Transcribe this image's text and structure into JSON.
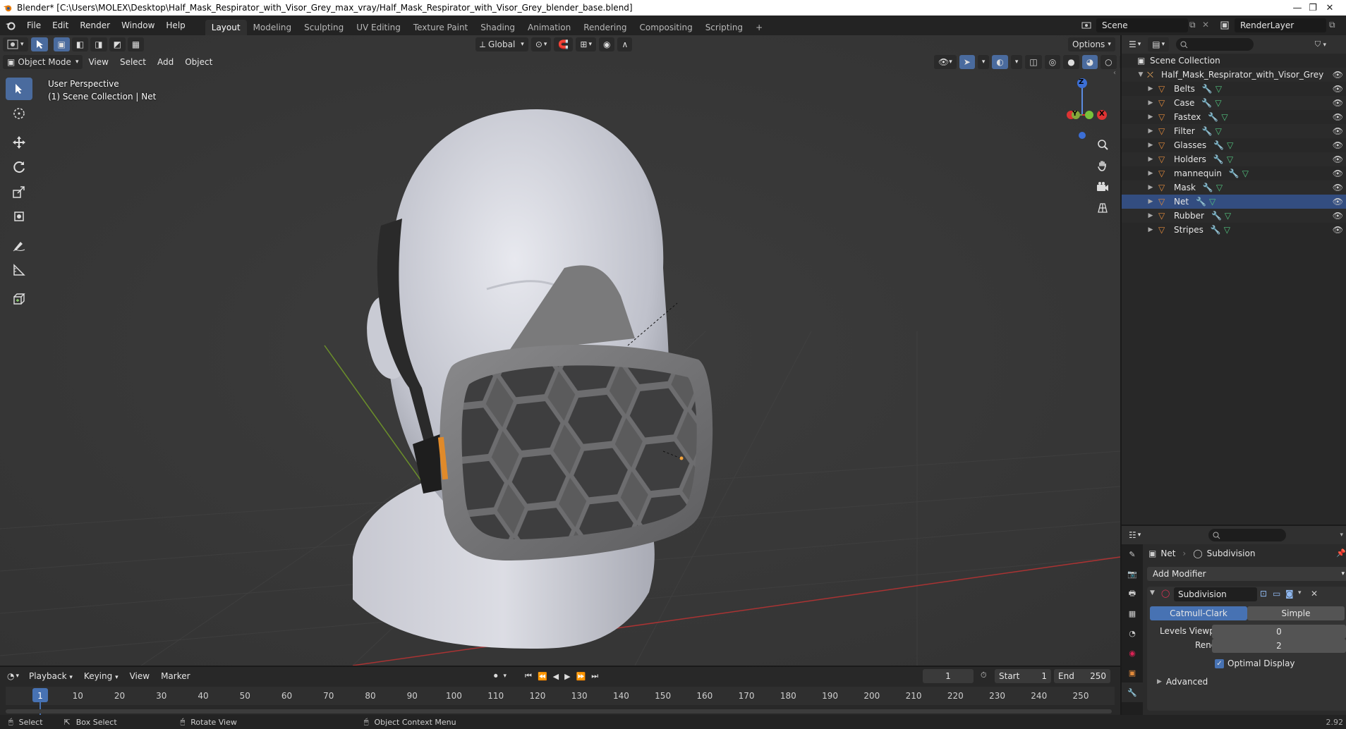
{
  "window": {
    "title": "Blender* [C:\\Users\\MOLEX\\Desktop\\Half_Mask_Respirator_with_Visor_Grey_max_vray/Half_Mask_Respirator_with_Visor_Grey_blender_base.blend]"
  },
  "menu": [
    "File",
    "Edit",
    "Render",
    "Window",
    "Help"
  ],
  "workspaces": [
    "Layout",
    "Modeling",
    "Sculpting",
    "UV Editing",
    "Texture Paint",
    "Shading",
    "Animation",
    "Rendering",
    "Compositing",
    "Scripting"
  ],
  "active_workspace": "Layout",
  "scene": {
    "name": "Scene",
    "view_layer": "RenderLayer"
  },
  "viewport": {
    "transform_orientation": "Global",
    "options_label": "Options",
    "mode": "Object Mode",
    "header_menus": [
      "View",
      "Select",
      "Add",
      "Object"
    ],
    "view_name": "User Perspective",
    "collection_info": "(1) Scene Collection | Net",
    "gizmo": {
      "z": "Z",
      "y": "Y",
      "x": "X"
    }
  },
  "outliner": {
    "root": "Scene Collection",
    "collection": "Half_Mask_Respirator_with_Visor_Grey",
    "objects": [
      "Belts",
      "Case",
      "Fastex",
      "Filter",
      "Glasses",
      "Holders",
      "mannequin",
      "Mask",
      "Net",
      "Rubber",
      "Stripes"
    ],
    "active_object": "Net"
  },
  "properties": {
    "object": "Net",
    "modifier_breadcrumb": "Subdivision",
    "add_modifier": "Add Modifier",
    "modifier_name": "Subdivision",
    "type_options": [
      "Catmull-Clark",
      "Simple"
    ],
    "selected_type": "Catmull-Clark",
    "levels_viewport_label": "Levels Viewport",
    "levels_viewport_value": "0",
    "render_label": "Render",
    "render_value": "2",
    "optimal_display_label": "Optimal Display",
    "optimal_display_checked": true,
    "advanced_label": "Advanced"
  },
  "timeline": {
    "menus": [
      "Playback",
      "Keying",
      "View",
      "Marker"
    ],
    "current_frame": "1",
    "start_label": "Start",
    "start_value": "1",
    "end_label": "End",
    "end_value": "250",
    "ruler": [
      "1",
      "10",
      "20",
      "30",
      "40",
      "50",
      "60",
      "70",
      "80",
      "90",
      "100",
      "110",
      "120",
      "130",
      "140",
      "150",
      "160",
      "170",
      "180",
      "190",
      "200",
      "210",
      "220",
      "230",
      "240",
      "250"
    ]
  },
  "statusbar": {
    "items": [
      "Select",
      "Box Select",
      "Rotate View",
      "Object Context Menu"
    ],
    "version": "2.92"
  },
  "colors": {
    "accent": "#4a6b9e",
    "selected_type": "#4772b3",
    "object_orange": "#e28a3b",
    "modifier_blue": "#6a9fe0",
    "mesh_green": "#52c27f"
  }
}
